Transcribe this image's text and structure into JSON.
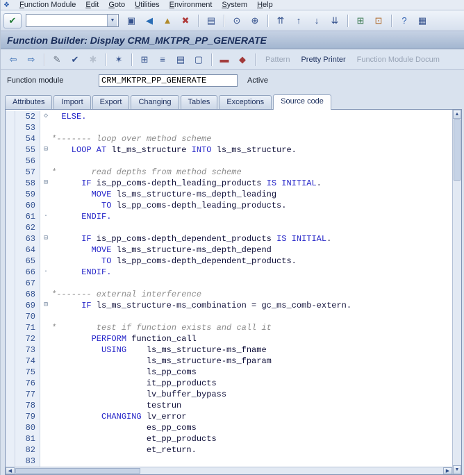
{
  "menubar": {
    "system_icon": {
      "name": "system-menu-icon",
      "glyph": "❖"
    },
    "items": [
      {
        "label": "Function Module"
      },
      {
        "label": "Edit"
      },
      {
        "label": "Goto"
      },
      {
        "label": "Utilities"
      },
      {
        "label": "Environment"
      },
      {
        "label": "System"
      },
      {
        "label": "Help"
      }
    ]
  },
  "standard_toolbar": {
    "enter_icon": {
      "name": "enter-icon",
      "glyph": "✔",
      "color": "#1f7a33"
    },
    "command_value": "",
    "combo_arrow_glyph": "▼",
    "icons": [
      {
        "name": "save-icon",
        "glyph": "▣",
        "color": "#33508c"
      },
      {
        "name": "back-icon",
        "glyph": "◀",
        "color": "#2a6db5"
      },
      {
        "name": "exit-icon",
        "glyph": "▲",
        "color": "#b08a2a"
      },
      {
        "name": "cancel-icon",
        "glyph": "✖",
        "color": "#b03a3a"
      },
      {
        "sep": true
      },
      {
        "name": "print-icon",
        "glyph": "▤",
        "color": "#33508c"
      },
      {
        "sep": true
      },
      {
        "name": "find-icon",
        "glyph": "⊙",
        "color": "#33508c"
      },
      {
        "name": "find-next-icon",
        "glyph": "⊕",
        "color": "#33508c"
      },
      {
        "sep": true
      },
      {
        "name": "first-page-icon",
        "glyph": "⇈",
        "color": "#33508c"
      },
      {
        "name": "page-up-icon",
        "glyph": "↑",
        "color": "#33508c"
      },
      {
        "name": "page-down-icon",
        "glyph": "↓",
        "color": "#33508c"
      },
      {
        "name": "last-page-icon",
        "glyph": "⇊",
        "color": "#33508c"
      },
      {
        "sep": true
      },
      {
        "name": "new-session-icon",
        "glyph": "⊞",
        "color": "#3c7a52"
      },
      {
        "name": "create-shortcut-icon",
        "glyph": "⊡",
        "color": "#b06a2a"
      },
      {
        "sep": true
      },
      {
        "name": "help-icon",
        "glyph": "?",
        "color": "#2a5db0"
      },
      {
        "name": "customize-layout-icon",
        "glyph": "▦",
        "color": "#33508c"
      }
    ]
  },
  "titlebar": {
    "title": "Function Builder: Display CRM_MKTPR_PP_GENERATE"
  },
  "app_toolbar": {
    "icons": [
      {
        "name": "back-icon",
        "glyph": "⇦",
        "color": "#2f66b0"
      },
      {
        "name": "forward-icon",
        "glyph": "⇨",
        "color": "#2f66b0"
      },
      {
        "sep": true
      },
      {
        "name": "display-change-icon",
        "glyph": "✎",
        "color": "#6b7685"
      },
      {
        "name": "check-icon",
        "glyph": "✔",
        "color": "#33508c"
      },
      {
        "name": "activate-icon",
        "glyph": "✱",
        "color": "#8a95a5",
        "disabled": true
      },
      {
        "sep": true
      },
      {
        "name": "test-icon",
        "glyph": "✶",
        "color": "#33508c"
      },
      {
        "sep": true
      },
      {
        "name": "where-used-icon",
        "glyph": "⊞",
        "color": "#33508c"
      },
      {
        "name": "object-list-icon",
        "glyph": "≡",
        "color": "#33508c"
      },
      {
        "name": "navigation-window-icon",
        "glyph": "▤",
        "color": "#33508c"
      },
      {
        "name": "fullscreen-icon",
        "glyph": "▢",
        "color": "#33508c"
      },
      {
        "sep": true
      },
      {
        "name": "documentation-icon",
        "glyph": "▬",
        "color": "#a23a3a"
      },
      {
        "name": "enhance-icon",
        "glyph": "◆",
        "color": "#a23a3a"
      },
      {
        "sep": true
      }
    ],
    "buttons": [
      {
        "name": "pattern-button",
        "label": "Pattern",
        "disabled": true
      },
      {
        "name": "pretty-printer-button",
        "label": "Pretty Printer",
        "disabled": false
      },
      {
        "name": "function-module-doc-button",
        "label": "Function Module Docum",
        "disabled": true
      }
    ]
  },
  "function_module_bar": {
    "label": "Function module",
    "value": "CRM_MKTPR_PP_GENERATE",
    "status": "Active"
  },
  "tabs": {
    "items": [
      {
        "label": "Attributes",
        "active": false
      },
      {
        "label": "Import",
        "active": false
      },
      {
        "label": "Export",
        "active": false
      },
      {
        "label": "Changing",
        "active": false
      },
      {
        "label": "Tables",
        "active": false
      },
      {
        "label": "Exceptions",
        "active": false
      },
      {
        "label": "Source code",
        "active": true
      }
    ]
  },
  "editor": {
    "colors": {
      "keyword": "#2424c8",
      "identifier": "#10103a",
      "comment": "#8c8c8c",
      "line_number": "#31508f"
    },
    "scrollbar": {
      "up_glyph": "▲",
      "down_glyph": "▼",
      "left_glyph": "◀",
      "right_glyph": "▶"
    },
    "fold_glyphs": {
      "d": "◇",
      "s": "⊟",
      "e": "·",
      "": ""
    },
    "lines": [
      {
        "n": 52,
        "fold": "d",
        "tokens": [
          {
            "t": "k",
            "v": "  ELSE."
          }
        ]
      },
      {
        "n": 53,
        "fold": "",
        "tokens": []
      },
      {
        "n": 54,
        "fold": "",
        "tokens": [
          {
            "t": "c",
            "v": "*------- loop over method scheme"
          }
        ]
      },
      {
        "n": 55,
        "fold": "s",
        "tokens": [
          {
            "t": "k",
            "v": "    LOOP AT"
          },
          {
            "t": "i",
            "v": " lt_ms_structure "
          },
          {
            "t": "k",
            "v": "INTO"
          },
          {
            "t": "i",
            "v": " ls_ms_structure."
          }
        ]
      },
      {
        "n": 56,
        "fold": "",
        "tokens": []
      },
      {
        "n": 57,
        "fold": "",
        "tokens": [
          {
            "t": "c",
            "v": "*       read depths from method scheme"
          }
        ]
      },
      {
        "n": 58,
        "fold": "s",
        "tokens": [
          {
            "t": "k",
            "v": "      IF"
          },
          {
            "t": "i",
            "v": " is_pp_coms-depth_leading_products "
          },
          {
            "t": "k",
            "v": "IS INITIAL"
          },
          {
            "t": "i",
            "v": "."
          }
        ]
      },
      {
        "n": 59,
        "fold": "",
        "tokens": [
          {
            "t": "k",
            "v": "        MOVE"
          },
          {
            "t": "i",
            "v": " ls_ms_structure-ms_depth_leading"
          }
        ]
      },
      {
        "n": 60,
        "fold": "",
        "tokens": [
          {
            "t": "k",
            "v": "          TO"
          },
          {
            "t": "i",
            "v": " ls_pp_coms-depth_leading_products."
          }
        ]
      },
      {
        "n": 61,
        "fold": "e",
        "tokens": [
          {
            "t": "k",
            "v": "      ENDIF."
          }
        ]
      },
      {
        "n": 62,
        "fold": "",
        "tokens": []
      },
      {
        "n": 63,
        "fold": "s",
        "tokens": [
          {
            "t": "k",
            "v": "      IF"
          },
          {
            "t": "i",
            "v": " is_pp_coms-depth_dependent_products "
          },
          {
            "t": "k",
            "v": "IS INITIAL"
          },
          {
            "t": "i",
            "v": "."
          }
        ]
      },
      {
        "n": 64,
        "fold": "",
        "tokens": [
          {
            "t": "k",
            "v": "        MOVE"
          },
          {
            "t": "i",
            "v": " ls_ms_structure-ms_depth_depend"
          }
        ]
      },
      {
        "n": 65,
        "fold": "",
        "tokens": [
          {
            "t": "k",
            "v": "          TO"
          },
          {
            "t": "i",
            "v": " ls_pp_coms-depth_dependent_products."
          }
        ]
      },
      {
        "n": 66,
        "fold": "e",
        "tokens": [
          {
            "t": "k",
            "v": "      ENDIF."
          }
        ]
      },
      {
        "n": 67,
        "fold": "",
        "tokens": []
      },
      {
        "n": 68,
        "fold": "",
        "tokens": [
          {
            "t": "c",
            "v": "*------- external interference"
          }
        ]
      },
      {
        "n": 69,
        "fold": "s",
        "tokens": [
          {
            "t": "k",
            "v": "      IF"
          },
          {
            "t": "i",
            "v": " ls_ms_structure-ms_combination = gc_ms_comb-extern."
          }
        ]
      },
      {
        "n": 70,
        "fold": "",
        "tokens": []
      },
      {
        "n": 71,
        "fold": "",
        "tokens": [
          {
            "t": "c",
            "v": "*        test if function exists and call it"
          }
        ]
      },
      {
        "n": 72,
        "fold": "",
        "tokens": [
          {
            "t": "k",
            "v": "        PERFORM"
          },
          {
            "t": "i",
            "v": " function_call"
          }
        ]
      },
      {
        "n": 73,
        "fold": "",
        "tokens": [
          {
            "t": "k",
            "v": "          USING"
          },
          {
            "t": "i",
            "v": "    ls_ms_structure-ms_fname"
          }
        ]
      },
      {
        "n": 74,
        "fold": "",
        "tokens": [
          {
            "t": "i",
            "v": "                   ls_ms_structure-ms_fparam"
          }
        ]
      },
      {
        "n": 75,
        "fold": "",
        "tokens": [
          {
            "t": "i",
            "v": "                   ls_pp_coms"
          }
        ]
      },
      {
        "n": 76,
        "fold": "",
        "tokens": [
          {
            "t": "i",
            "v": "                   it_pp_products"
          }
        ]
      },
      {
        "n": 77,
        "fold": "",
        "tokens": [
          {
            "t": "i",
            "v": "                   lv_buffer_bypass"
          }
        ]
      },
      {
        "n": 78,
        "fold": "",
        "tokens": [
          {
            "t": "i",
            "v": "                   testrun"
          }
        ]
      },
      {
        "n": 79,
        "fold": "",
        "tokens": [
          {
            "t": "k",
            "v": "          CHANGING"
          },
          {
            "t": "i",
            "v": " lv_error"
          }
        ]
      },
      {
        "n": 80,
        "fold": "",
        "tokens": [
          {
            "t": "i",
            "v": "                   es_pp_coms"
          }
        ]
      },
      {
        "n": 81,
        "fold": "",
        "tokens": [
          {
            "t": "i",
            "v": "                   et_pp_products"
          }
        ]
      },
      {
        "n": 82,
        "fold": "",
        "tokens": [
          {
            "t": "i",
            "v": "                   et_return."
          }
        ]
      },
      {
        "n": 83,
        "fold": "",
        "tokens": []
      }
    ]
  }
}
